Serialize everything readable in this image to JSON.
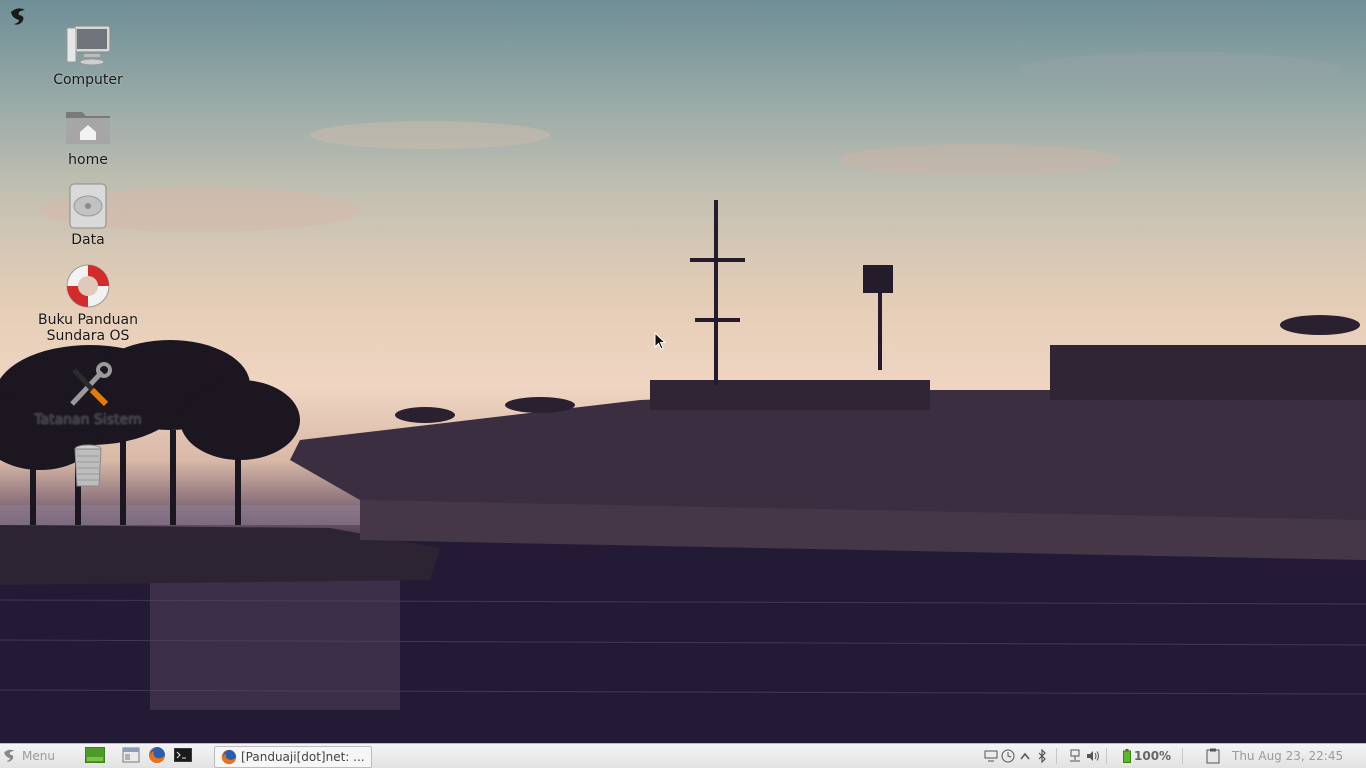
{
  "desktop": {
    "icons": [
      {
        "label": "Computer",
        "icon": "computer-icon"
      },
      {
        "label": "home",
        "icon": "home-folder-icon"
      },
      {
        "label": "Data",
        "icon": "hard-drive-icon"
      },
      {
        "label": "Buku Panduan Sundara OS",
        "icon": "lifebuoy-help-icon"
      },
      {
        "label": "Tatanan Sistem",
        "icon": "system-settings-icon"
      },
      {
        "label": "",
        "icon": "trash-icon"
      }
    ]
  },
  "taskbar": {
    "menu_label": "Menu",
    "launchers": [
      "show-desktop-icon",
      "file-manager-icon",
      "firefox-icon",
      "terminal-icon"
    ],
    "task_label": "[Panduaji[dot]net: ...",
    "tray_icons": [
      "display-icon",
      "clock-icon",
      "chevron-up-icon",
      "bluetooth-icon",
      "network-icon",
      "volume-icon",
      "battery-icon"
    ],
    "battery_percent": "100%",
    "clock": "Thu Aug 23, 22:45"
  },
  "colors": {
    "sky_top": "#6f8e96",
    "sky_glow": "#efd5c2",
    "water": "#241c36",
    "taskbar": "#e8e8e8"
  }
}
